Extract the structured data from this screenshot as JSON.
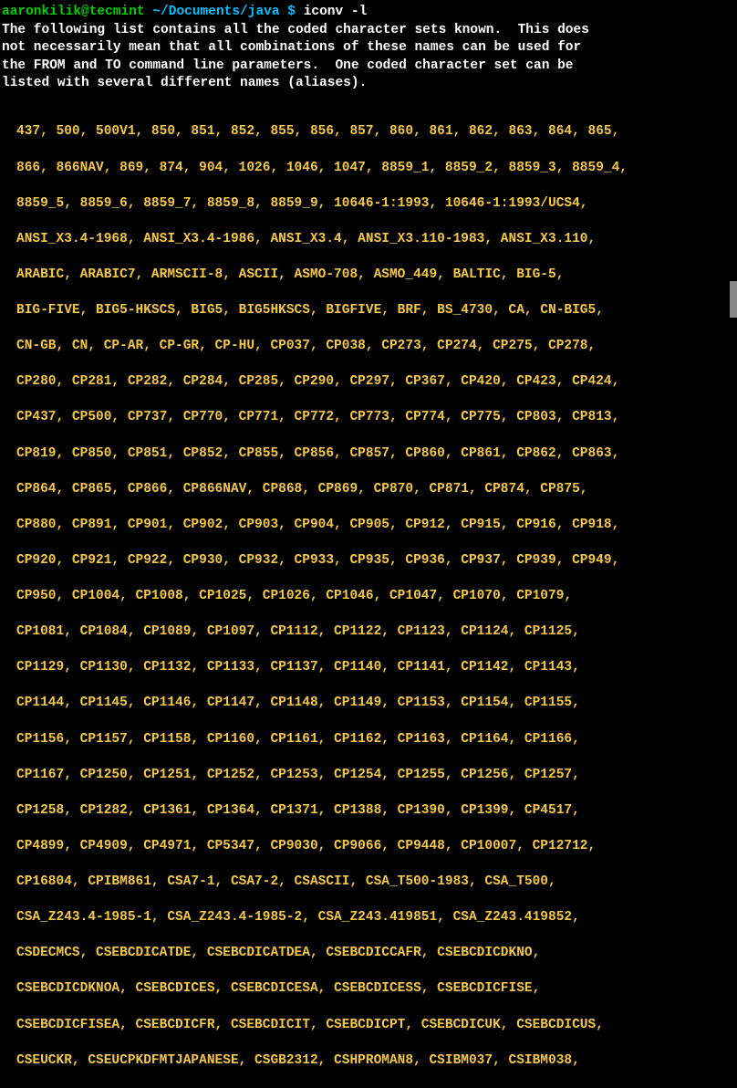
{
  "prompt": {
    "user_host": "aaronkilik@tecmint",
    "path": "~/Documents/java",
    "dollar": "$",
    "command": "iconv -l"
  },
  "intro_lines": [
    "The following list contains all the coded character sets known.  This does",
    "not necessarily mean that all combinations of these names can be used for",
    "the FROM and TO command line parameters.  One coded character set can be",
    "listed with several different names (aliases)."
  ],
  "charset_lines": [
    "437, 500, 500V1, 850, 851, 852, 855, 856, 857, 860, 861, 862, 863, 864, 865,",
    "866, 866NAV, 869, 874, 904, 1026, 1046, 1047, 8859_1, 8859_2, 8859_3, 8859_4,",
    "8859_5, 8859_6, 8859_7, 8859_8, 8859_9, 10646-1:1993, 10646-1:1993/UCS4,",
    "ANSI_X3.4-1968, ANSI_X3.4-1986, ANSI_X3.4, ANSI_X3.110-1983, ANSI_X3.110,",
    "ARABIC, ARABIC7, ARMSCII-8, ASCII, ASMO-708, ASMO_449, BALTIC, BIG-5,",
    "BIG-FIVE, BIG5-HKSCS, BIG5, BIG5HKSCS, BIGFIVE, BRF, BS_4730, CA, CN-BIG5,",
    "CN-GB, CN, CP-AR, CP-GR, CP-HU, CP037, CP038, CP273, CP274, CP275, CP278,",
    "CP280, CP281, CP282, CP284, CP285, CP290, CP297, CP367, CP420, CP423, CP424,",
    "CP437, CP500, CP737, CP770, CP771, CP772, CP773, CP774, CP775, CP803, CP813,",
    "CP819, CP850, CP851, CP852, CP855, CP856, CP857, CP860, CP861, CP862, CP863,",
    "CP864, CP865, CP866, CP866NAV, CP868, CP869, CP870, CP871, CP874, CP875,",
    "CP880, CP891, CP901, CP902, CP903, CP904, CP905, CP912, CP915, CP916, CP918,",
    "CP920, CP921, CP922, CP930, CP932, CP933, CP935, CP936, CP937, CP939, CP949,",
    "CP950, CP1004, CP1008, CP1025, CP1026, CP1046, CP1047, CP1070, CP1079,",
    "CP1081, CP1084, CP1089, CP1097, CP1112, CP1122, CP1123, CP1124, CP1125,",
    "CP1129, CP1130, CP1132, CP1133, CP1137, CP1140, CP1141, CP1142, CP1143,",
    "CP1144, CP1145, CP1146, CP1147, CP1148, CP1149, CP1153, CP1154, CP1155,",
    "CP1156, CP1157, CP1158, CP1160, CP1161, CP1162, CP1163, CP1164, CP1166,",
    "CP1167, CP1250, CP1251, CP1252, CP1253, CP1254, CP1255, CP1256, CP1257,",
    "CP1258, CP1282, CP1361, CP1364, CP1371, CP1388, CP1390, CP1399, CP4517,",
    "CP4899, CP4909, CP4971, CP5347, CP9030, CP9066, CP9448, CP10007, CP12712,",
    "CP16804, CPIBM861, CSA7-1, CSA7-2, CSASCII, CSA_T500-1983, CSA_T500,",
    "CSA_Z243.4-1985-1, CSA_Z243.4-1985-2, CSA_Z243.419851, CSA_Z243.419852,",
    "CSDECMCS, CSEBCDICATDE, CSEBCDICATDEA, CSEBCDICCAFR, CSEBCDICDKNO,",
    "CSEBCDICDKNOA, CSEBCDICES, CSEBCDICESA, CSEBCDICESS, CSEBCDICFISE,",
    "CSEBCDICFISEA, CSEBCDICFR, CSEBCDICIT, CSEBCDICPT, CSEBCDICUK, CSEBCDICUS,",
    "CSEUCKR, CSEUCPKDFMTJAPANESE, CSGB2312, CSHPROMAN8, CSIBM037, CSIBM038,"
  ]
}
